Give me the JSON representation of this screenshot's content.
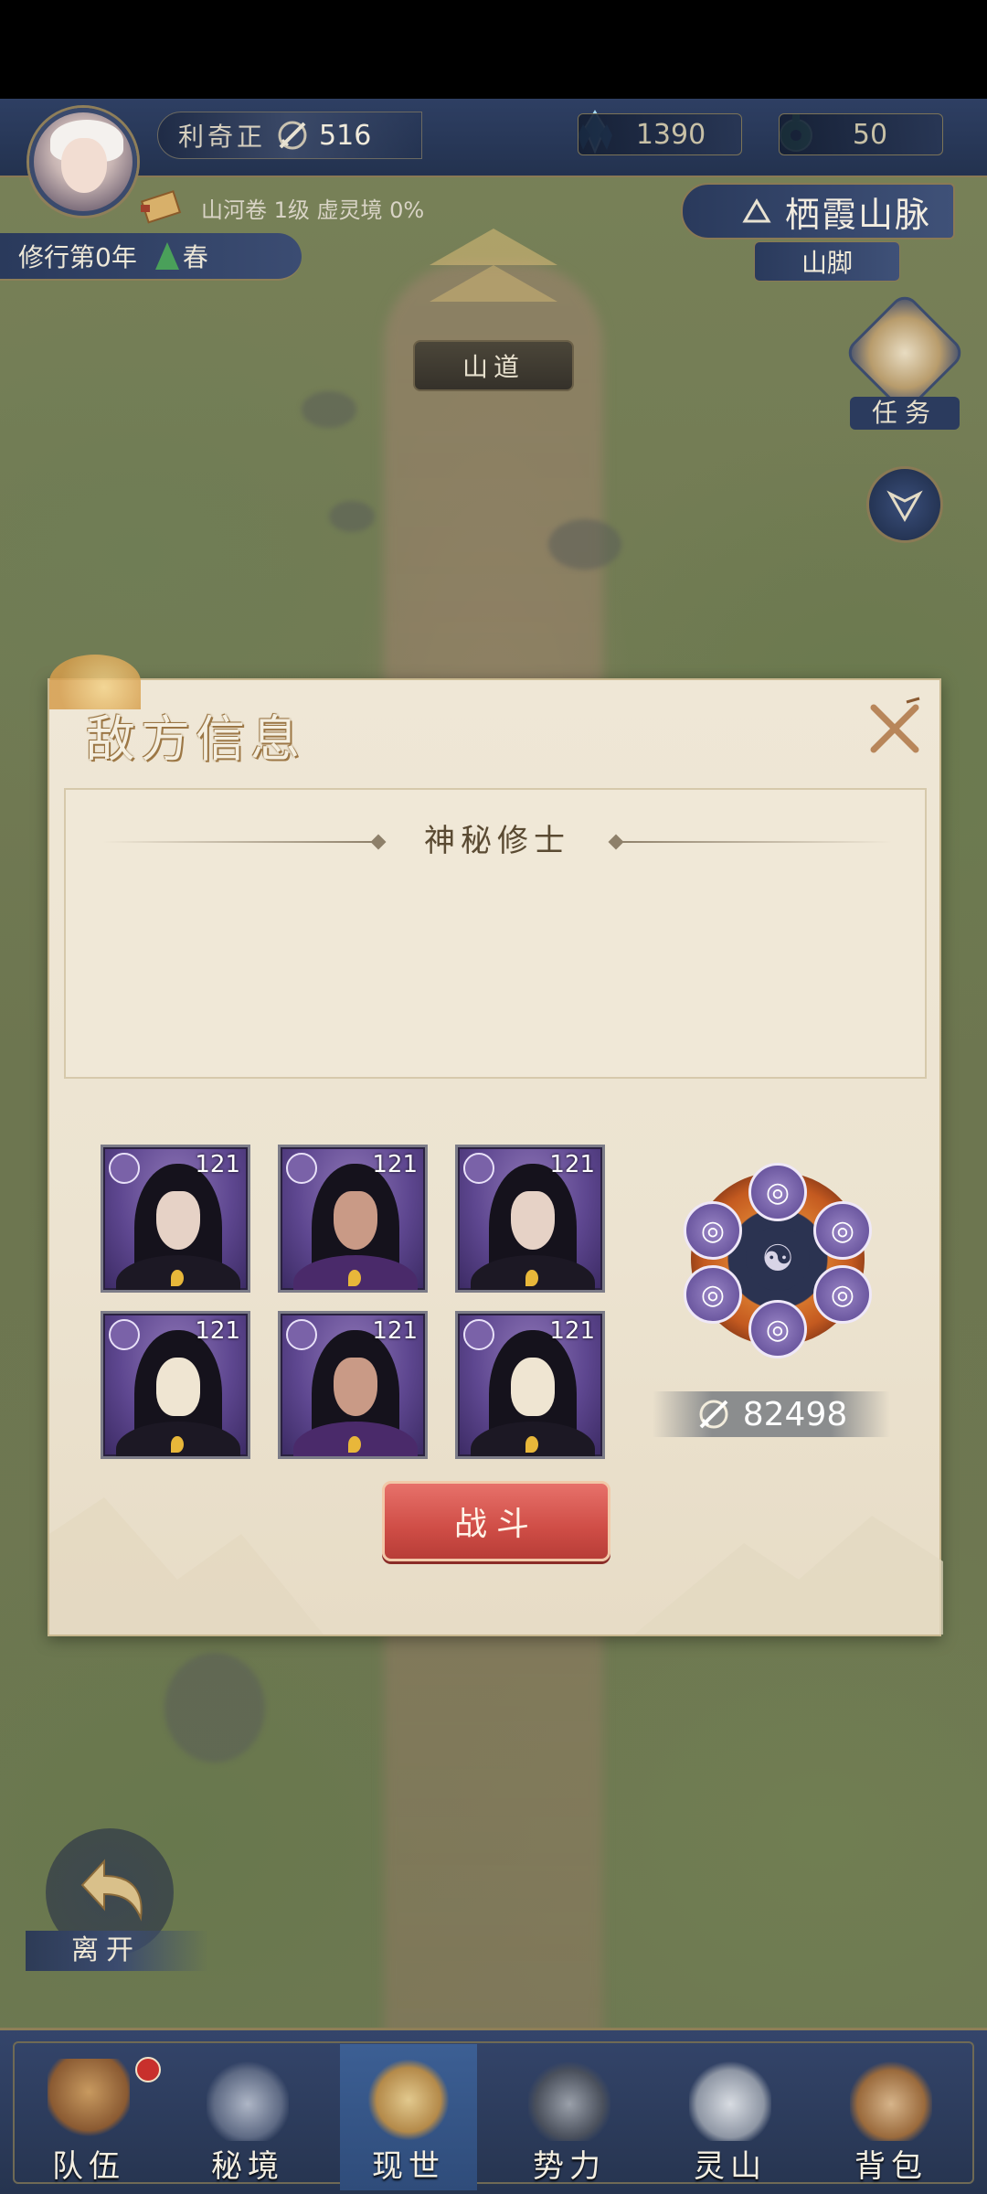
{
  "player": {
    "name": "利奇正",
    "power": "516",
    "chapter": "山河卷 1级 虚灵境 0%",
    "year": "修行第0年",
    "season": "春"
  },
  "resources": {
    "crystal": "1390",
    "jade": "50"
  },
  "location": {
    "name": "栖霞山脉",
    "sub": "山脚",
    "path_sign": "山道"
  },
  "side_buttons": {
    "task": "任务"
  },
  "dialog": {
    "title": "敌方信息",
    "enemy_name": "神秘修士",
    "enemies": [
      {
        "level": "121",
        "type": "swordsman"
      },
      {
        "level": "121",
        "type": "ghoul"
      },
      {
        "level": "121",
        "type": "swordsman"
      },
      {
        "level": "121",
        "type": "skull-mask"
      },
      {
        "level": "121",
        "type": "ghoul"
      },
      {
        "level": "121",
        "type": "skull-mask"
      }
    ],
    "total_power": "82498",
    "fight_label": "战斗"
  },
  "leave_label": "离开",
  "nav": [
    {
      "label": "队伍",
      "icon": "team-icon",
      "active": false,
      "badge": true
    },
    {
      "label": "秘境",
      "icon": "secret-realm-icon",
      "active": false,
      "badge": false
    },
    {
      "label": "现世",
      "icon": "world-map-icon",
      "active": true,
      "badge": false
    },
    {
      "label": "势力",
      "icon": "faction-icon",
      "active": false,
      "badge": false
    },
    {
      "label": "灵山",
      "icon": "spirit-mountain-icon",
      "active": false,
      "badge": false
    },
    {
      "label": "背包",
      "icon": "backpack-icon",
      "active": false,
      "badge": false
    }
  ],
  "colors": {
    "hud_blue": "#2e3f63",
    "gold_border": "#8a7a55",
    "fight_red": "#cf4d46",
    "enemy_purple": "#5e4790"
  }
}
